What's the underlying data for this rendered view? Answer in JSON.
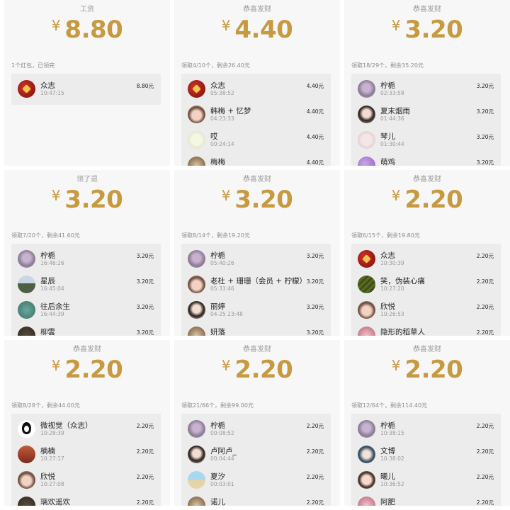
{
  "panels": [
    {
      "title": "工资",
      "amount": "8.80",
      "currency": "¥",
      "summary": "1个红包，已领完",
      "rows": [
        {
          "name": "众志",
          "time": "10:47:15",
          "amount": "8.80元",
          "avatar": "av-red"
        }
      ]
    },
    {
      "title": "恭喜发财",
      "amount": "4.40",
      "currency": "¥",
      "summary": "领取4/10个，剩余26.40元",
      "rows": [
        {
          "name": "众志",
          "time": "05:38:52",
          "amount": "4.40元",
          "avatar": "av-red"
        },
        {
          "name": "韩梅 + 忆梦",
          "time": "04:23:33",
          "amount": "4.40元",
          "avatar": "av-girl1"
        },
        {
          "name": "哎",
          "time": "00:24:14",
          "amount": "4.40元",
          "avatar": "av-green"
        },
        {
          "name": "梅梅",
          "time": "",
          "amount": "4.40元",
          "avatar": "av-brown"
        }
      ]
    },
    {
      "title": "恭喜发财",
      "amount": "3.20",
      "currency": "¥",
      "summary": "领取18/29个，剩余35.20元",
      "rows": [
        {
          "name": "柠栀",
          "time": "02:33:58",
          "amount": "3.20元",
          "avatar": "av-flower"
        },
        {
          "name": "夏末烟雨",
          "time": "01:44:36",
          "amount": "3.20元",
          "avatar": "av-girl2"
        },
        {
          "name": "琴儿",
          "time": "01:30:44",
          "amount": "3.20元",
          "avatar": "av-pale"
        },
        {
          "name": "萌鸡",
          "time": "",
          "amount": "3.20元",
          "avatar": "av-purple"
        }
      ]
    },
    {
      "title": "领了退",
      "amount": "3.20",
      "currency": "¥",
      "summary": "领取7/20个，剩余41.60元",
      "rows": [
        {
          "name": "柠栀",
          "time": "16:46:26",
          "amount": "3.20元",
          "avatar": "av-flower"
        },
        {
          "name": "星辰",
          "time": "16:45:04",
          "amount": "3.20元",
          "avatar": "av-land"
        },
        {
          "name": "往后余生",
          "time": "16:44:39",
          "amount": "3.20元",
          "avatar": "av-teal"
        },
        {
          "name": "柳雲",
          "time": "",
          "amount": "3.20元",
          "avatar": "av-dark"
        }
      ]
    },
    {
      "title": "恭喜发财",
      "amount": "3.20",
      "currency": "¥",
      "summary": "领取8/14个，剩余19.20元",
      "rows": [
        {
          "name": "柠栀",
          "time": "05:40:26",
          "amount": "3.20元",
          "avatar": "av-flower"
        },
        {
          "name": "老杜 + 珊珊（会员 + 柠檬）",
          "time": "05:33:46",
          "amount": "3.20元",
          "avatar": "av-girl1"
        },
        {
          "name": "丽婷",
          "time": "04-25 23:48",
          "amount": "3.20元",
          "avatar": "av-girl2"
        },
        {
          "name": "妍落",
          "time": "",
          "amount": "3.20元",
          "avatar": "av-brown"
        }
      ]
    },
    {
      "title": "恭喜发财",
      "amount": "2.20",
      "currency": "¥",
      "summary": "领取6/15个，剩余19.80元",
      "rows": [
        {
          "name": "众志",
          "time": "10:30:39",
          "amount": "2.20元",
          "avatar": "av-red"
        },
        {
          "name": "笑，伪装心痛",
          "time": "10:27:20",
          "amount": "2.20元",
          "avatar": "av-olive"
        },
        {
          "name": "欣悦",
          "time": "10:26:53",
          "amount": "2.20元",
          "avatar": "av-girl1"
        },
        {
          "name": "隐形的稻草人",
          "time": "",
          "amount": "2.20元",
          "avatar": "av-rose"
        }
      ]
    },
    {
      "title": "恭喜发财",
      "amount": "2.20",
      "currency": "¥",
      "summary": "领取8/28个，剩余44.00元",
      "rows": [
        {
          "name": "微视觉（众志）",
          "time": "10:28:39",
          "amount": "2.20元",
          "avatar": "av-penguin"
        },
        {
          "name": "楠楠",
          "time": "10:27:17",
          "amount": "2.20元",
          "avatar": "av-brick"
        },
        {
          "name": "欣悦",
          "time": "10:27:08",
          "amount": "2.20元",
          "avatar": "av-girl1"
        },
        {
          "name": "璃欢遥欢",
          "time": "",
          "amount": "2.20元",
          "avatar": "av-dark"
        }
      ]
    },
    {
      "title": "恭喜发财",
      "amount": "2.20",
      "currency": "¥",
      "summary": "领取21/66个，剩余99.00元",
      "rows": [
        {
          "name": "柠栀",
          "time": "00:08:52",
          "amount": "2.20元",
          "avatar": "av-flower"
        },
        {
          "name": "卢阿卢_",
          "time": "00:04:44",
          "amount": "2.20元",
          "avatar": "av-girl2"
        },
        {
          "name": "夏汐",
          "time": "00:03:01",
          "amount": "2.20元",
          "avatar": "av-beach"
        },
        {
          "name": "诺儿",
          "time": "",
          "amount": "2.20元",
          "avatar": "av-brown"
        }
      ]
    },
    {
      "title": "恭喜发财",
      "amount": "2.20",
      "currency": "¥",
      "summary": "领取12/64个，剩余114.40元",
      "rows": [
        {
          "name": "柠栀",
          "time": "10:38:15",
          "amount": "2.20元",
          "avatar": "av-flower"
        },
        {
          "name": "文博",
          "time": "10:38:02",
          "amount": "2.20元",
          "avatar": "av-anime"
        },
        {
          "name": "曦儿",
          "time": "10:36:52",
          "amount": "2.20元",
          "avatar": "av-child"
        },
        {
          "name": "阿肥",
          "time": "",
          "amount": "2.20元",
          "avatar": "av-rose"
        }
      ]
    }
  ]
}
